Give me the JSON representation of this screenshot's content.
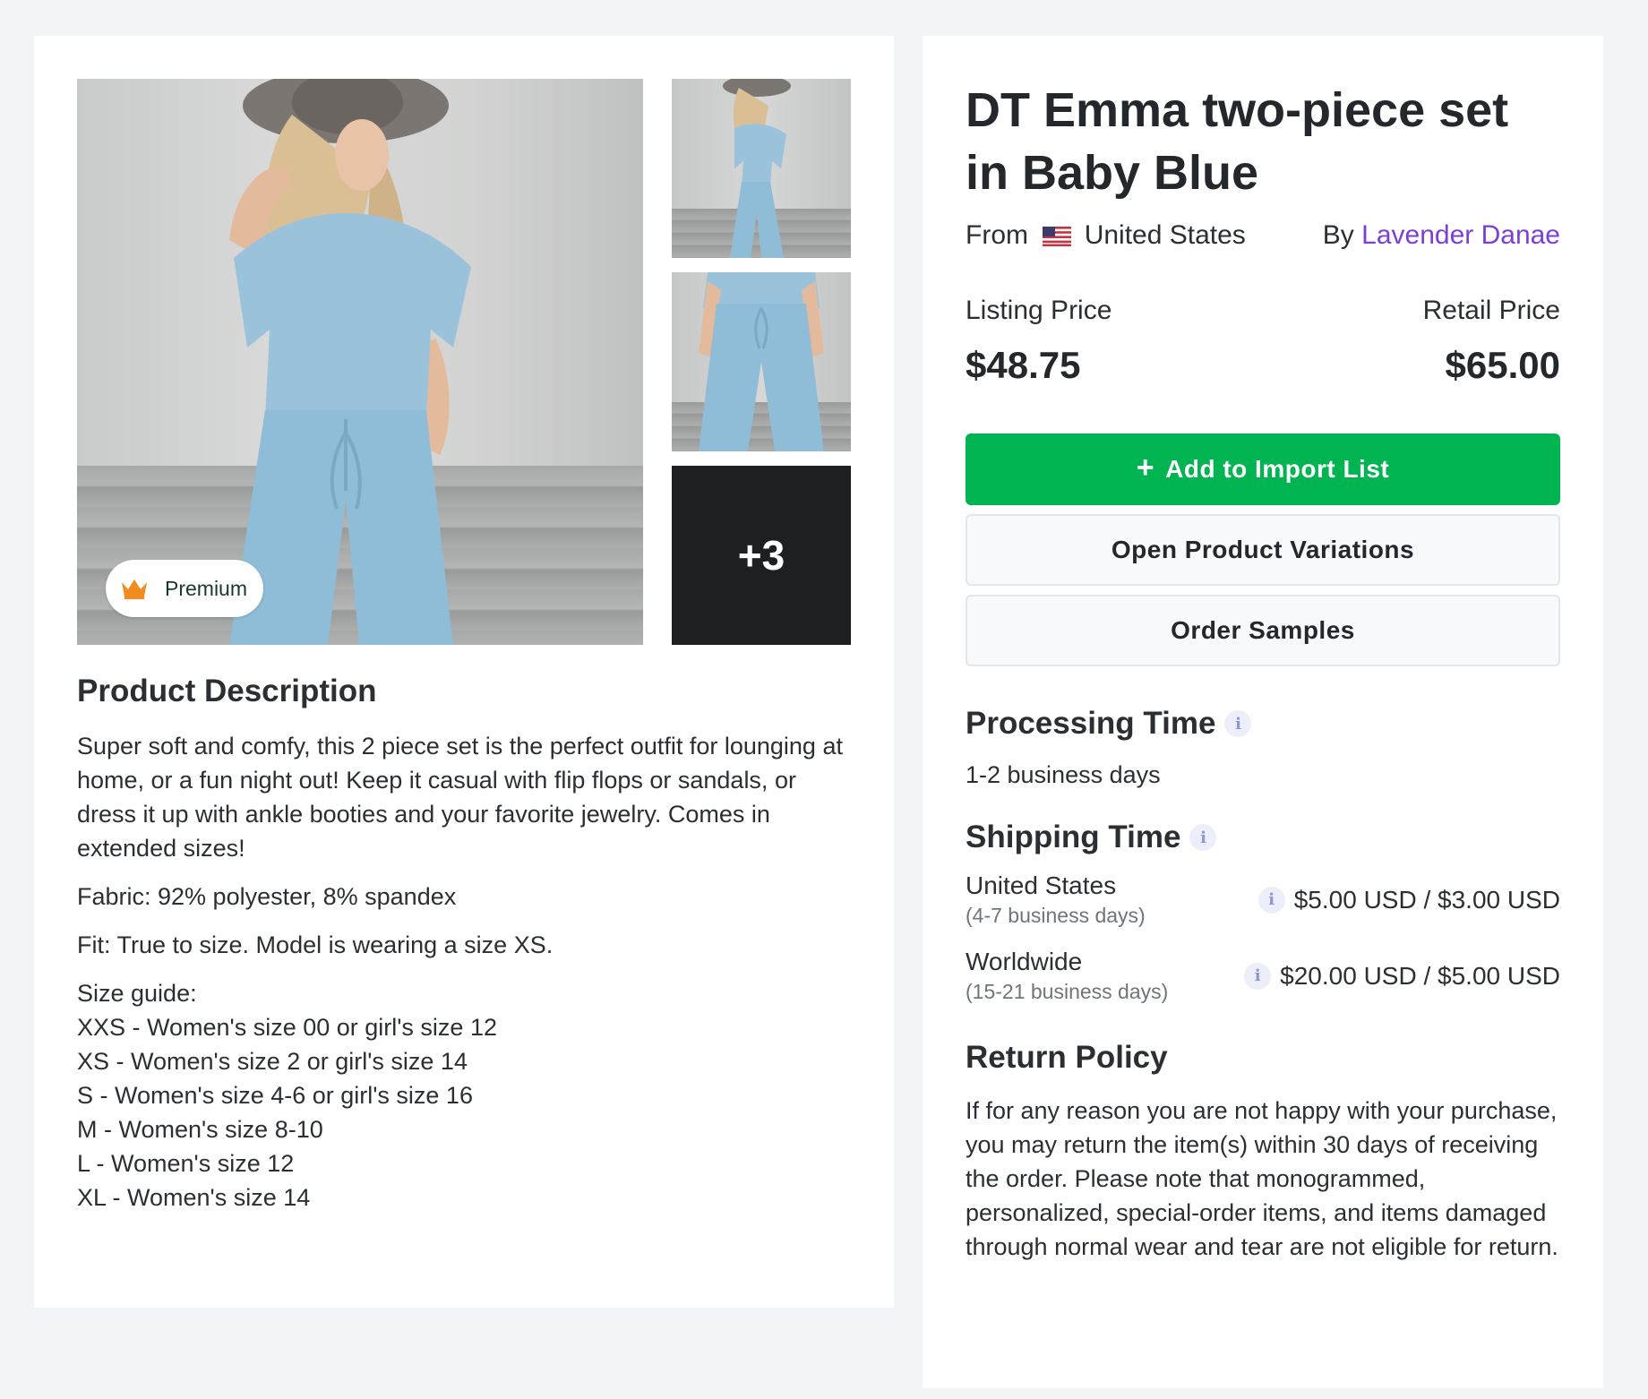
{
  "product": {
    "title": "DT Emma two-piece set in Baby Blue",
    "from_prefix": "From",
    "origin_country": "United States",
    "by_prefix": "By",
    "vendor": "Lavender Danae",
    "listing_price_label": "Listing Price",
    "listing_price": "$48.75",
    "retail_price_label": "Retail Price",
    "retail_price": "$65.00"
  },
  "gallery": {
    "premium_label": "Premium",
    "more_count": "+3"
  },
  "actions": {
    "add_plus": "+",
    "add_label": "Add to Import List",
    "variations_label": "Open Product Variations",
    "samples_label": "Order Samples"
  },
  "description": {
    "title": "Product Description",
    "body": "Super soft and comfy, this 2 piece set is the perfect outfit for lounging at home, or a fun night out!  Keep it casual with flip flops or sandals, or dress it up with ankle booties and your favorite jewelry.  Comes in extended sizes!",
    "fabric": "Fabric: 92% polyester, 8% spandex",
    "fit": "Fit: True to size.  Model is wearing a size XS.",
    "size_guide_title": "Size guide:",
    "sizes": [
      "XXS - Women's size 00 or girl's size 12",
      "XS - Women's size 2  or girl's size 14",
      "S - Women's size 4-6 or girl's size 16",
      "M - Women's size 8-10",
      "L - Women's size 12",
      "XL - Women's size 14"
    ]
  },
  "processing": {
    "title": "Processing Time",
    "info_glyph": "i",
    "value": "1-2 business days"
  },
  "shipping": {
    "title": "Shipping Time",
    "info_glyph": "i",
    "rows": [
      {
        "region": "United States",
        "days": "(4-7 business days)",
        "price": "$5.00 USD / $3.00 USD"
      },
      {
        "region": "Worldwide",
        "days": "(15-21 business days)",
        "price": "$20.00 USD / $5.00 USD"
      }
    ]
  },
  "return_policy": {
    "title": "Return Policy",
    "text": "If for any reason you are not happy with your purchase, you may return the item(s) within 30 days of receiving the order. Please note that monogrammed, personalized, special-order items, and items damaged through normal wear and tear are not eligible for return."
  },
  "colors": {
    "accent_green": "#00b551",
    "link_purple": "#7c3fd6",
    "page_bg": "#f2f4f7",
    "crown_orange": "#f28c1c"
  }
}
